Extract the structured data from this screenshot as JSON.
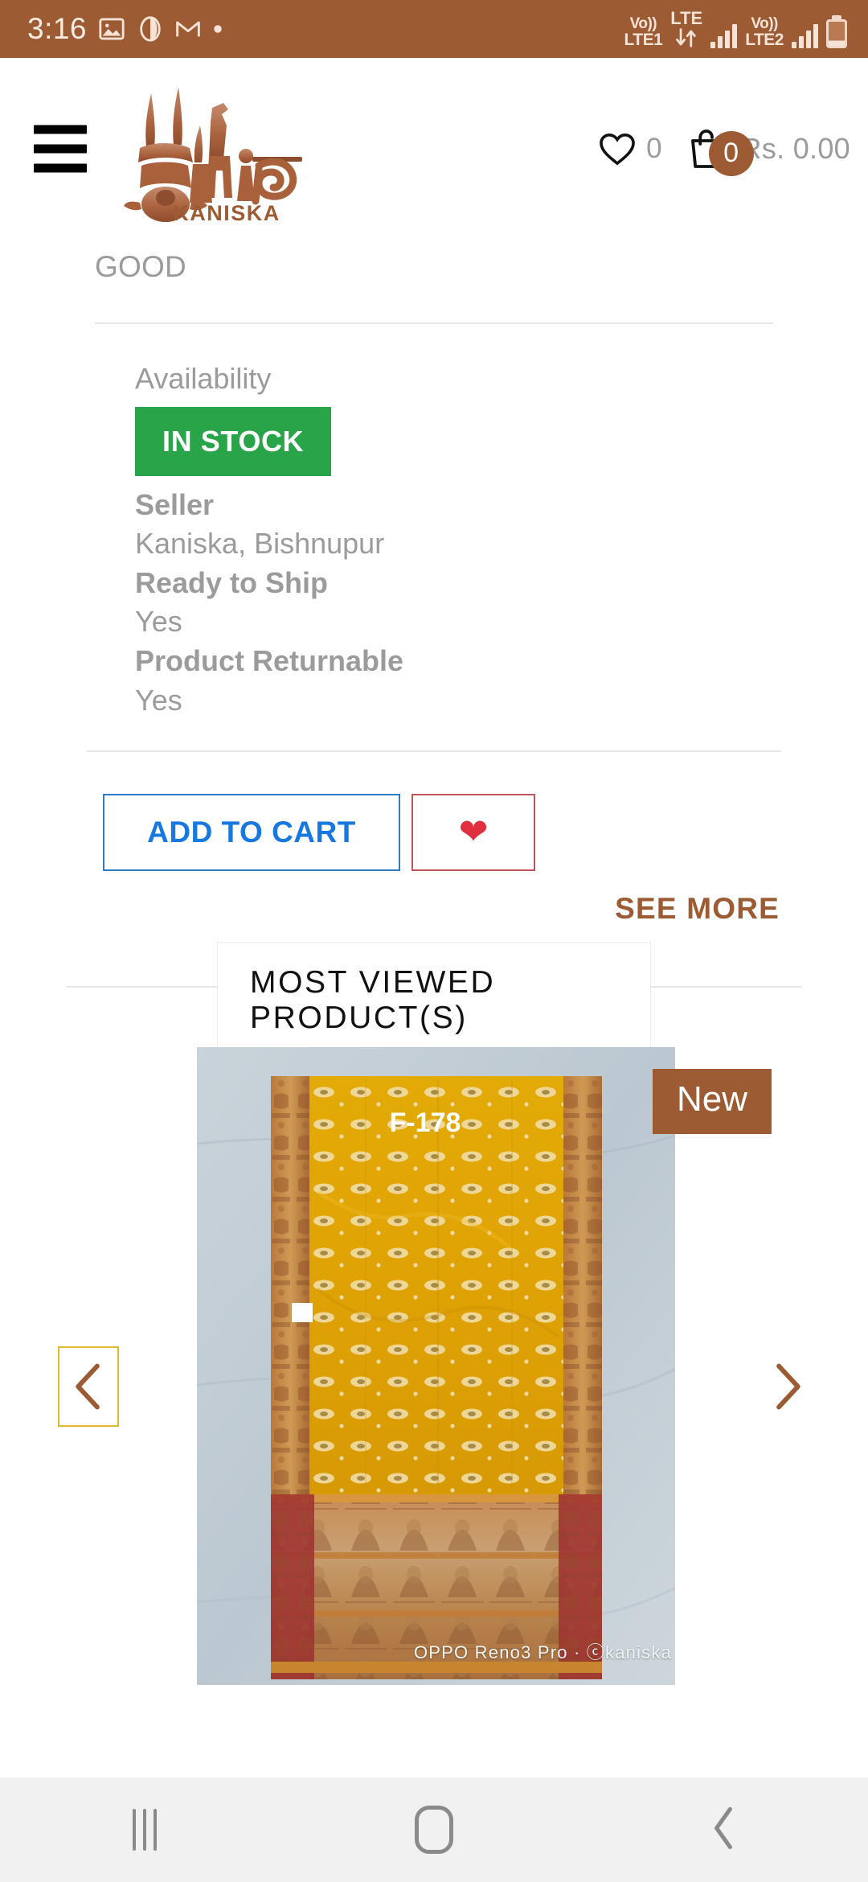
{
  "status_bar": {
    "time": "3:16",
    "icons": [
      "image-icon",
      "opera-icon",
      "gmail-icon",
      "dot-icon"
    ],
    "sim1_volte": "Vo))",
    "sim1_label": "LTE1",
    "lte_label": "LTE",
    "sim2_volte": "Vo))",
    "sim2_label": "LTE2",
    "bg_color": "#9c5b33"
  },
  "header": {
    "menu_icon": "hamburger-icon",
    "logo_text": "কানিষ্ক",
    "logo_sub": "KANISKA",
    "wishlist_count": "0",
    "cart_count": "0",
    "cart_total": "Rs. 0.00",
    "accent_color": "#9c5b33"
  },
  "product": {
    "grade": "GOOD",
    "availability_label": "Availability",
    "availability_value": "IN STOCK",
    "availability_color": "#2aa448",
    "seller_label": "Seller",
    "seller_value": "Kaniska, Bishnupur",
    "ready_label": "Ready to Ship",
    "ready_value": "Yes",
    "returnable_label": "Product Returnable",
    "returnable_value": "Yes"
  },
  "actions": {
    "add_to_cart": "ADD TO CART",
    "wishlist_icon": "heart-icon",
    "see_more": "SEE MORE",
    "cart_border_color": "#2f7cc4",
    "cart_text_color": "#1778e0",
    "wish_border_color": "#c0545c",
    "wish_heart_color": "#e03040",
    "see_more_color": "#9c5b33"
  },
  "most_viewed": {
    "section_title": "MOST VIEWED PRODUCT(S)",
    "badge": "New",
    "badge_color": "#9c5b33",
    "image_code": "F-178",
    "image_watermark": "OPPO Reno3 Pro · ⓒkaniska",
    "prev_icon": "chevron-left-icon",
    "next_icon": "chevron-right-icon",
    "arrow_color": "#9c5b33",
    "focus_outline_color": "#e0b92d"
  },
  "nav_bar": {
    "recents": "recents-icon",
    "home": "home-icon",
    "back": "back-icon",
    "bg_color": "#f1f1f1"
  }
}
